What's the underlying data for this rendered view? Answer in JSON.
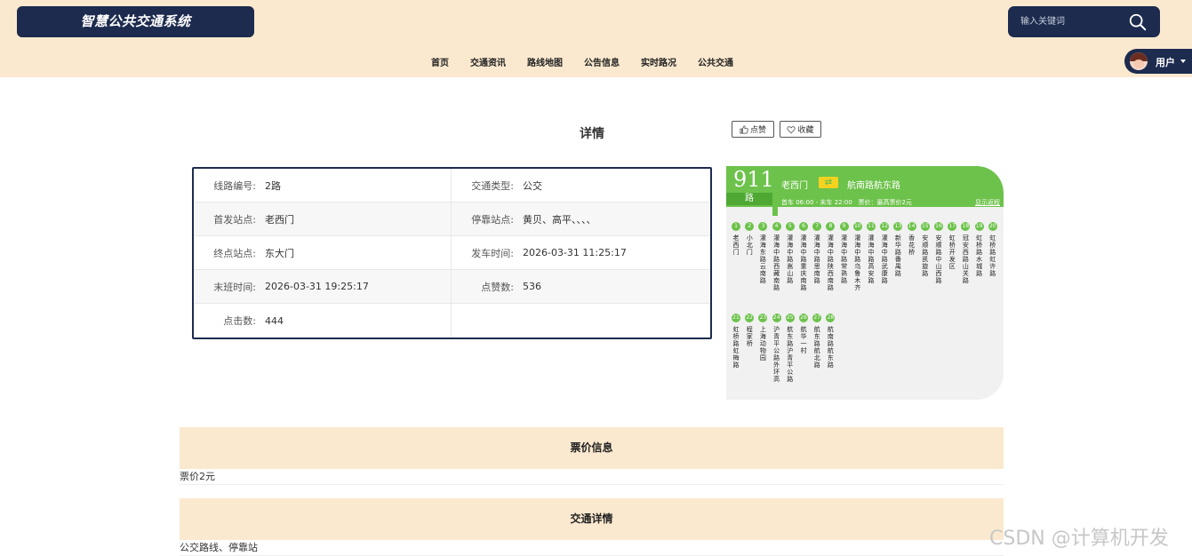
{
  "header": {
    "logo": "智慧公共交通系统",
    "search_placeholder": "输入关键词",
    "nav": [
      "首页",
      "交通资讯",
      "路线地图",
      "公告信息",
      "实时路况",
      "公共交通"
    ],
    "user_label": "用户"
  },
  "detail": {
    "title": "详情",
    "like_label": "点赞",
    "fav_label": "收藏",
    "rows": [
      {
        "label": "线路编号:",
        "value": "2路"
      },
      {
        "label": "交通类型:",
        "value": "公交"
      },
      {
        "label": "首发站点:",
        "value": "老西门"
      },
      {
        "label": "停靠站点:",
        "value": "黄贝、高平、、、、"
      },
      {
        "label": "终点站点:",
        "value": "东大门"
      },
      {
        "label": "发车时间:",
        "value": "2026-03-31 11:25:17"
      },
      {
        "label": "末班时间:",
        "value": "2026-03-31 19:25:17"
      },
      {
        "label": "点赞数:",
        "value": "536"
      },
      {
        "label": "点击数:",
        "value": "444"
      }
    ]
  },
  "route_image": {
    "number": "911",
    "suffix": "路",
    "from": "老西门",
    "to": "航南路航东路",
    "schedule": "首车 06:00 - 末车 22:00",
    "fare": "票价：最高票价2元",
    "back_link": "显示返程",
    "stops_row1": [
      {
        "no": "1",
        "name": "老西门"
      },
      {
        "no": "2",
        "name": "小北门"
      },
      {
        "no": "3",
        "name": "灌海东路云南路"
      },
      {
        "no": "4",
        "name": "灌海中路西藏南路"
      },
      {
        "no": "5",
        "name": "灌海中路嵩山路"
      },
      {
        "no": "6",
        "name": "灌海中路重庆南路"
      },
      {
        "no": "7",
        "name": "灌海中路思南路"
      },
      {
        "no": "8",
        "name": "灌海中路陕西南路"
      },
      {
        "no": "9",
        "name": "灌海中路常熟路"
      },
      {
        "no": "10",
        "name": "灌海中路乌鲁木齐"
      },
      {
        "no": "11",
        "name": "灌海中路高安路"
      },
      {
        "no": "12",
        "name": "灌海中路武康路"
      },
      {
        "no": "13",
        "name": "新华路番禺路"
      },
      {
        "no": "14",
        "name": "香花桥"
      },
      {
        "no": "15",
        "name": "安顺路凯旋路"
      },
      {
        "no": "16",
        "name": "安顺路中山西路"
      },
      {
        "no": "17",
        "name": "虹桥开发区"
      },
      {
        "no": "18",
        "name": "冠安西路山关路"
      },
      {
        "no": "19",
        "name": "虹桥路水城路"
      },
      {
        "no": "20",
        "name": "虹桥路虹许路"
      }
    ],
    "stops_row2": [
      {
        "no": "21",
        "name": "虹桥路虹梅路"
      },
      {
        "no": "22",
        "name": "程家桥"
      },
      {
        "no": "23",
        "name": "上海动物园"
      },
      {
        "no": "24",
        "name": "沪青平公路外环高"
      },
      {
        "no": "25",
        "name": "航东路沪青平公路"
      },
      {
        "no": "26",
        "name": "航华一村"
      },
      {
        "no": "27",
        "name": "航东路航北路"
      },
      {
        "no": "28",
        "name": "航南路航东路"
      }
    ]
  },
  "fare_section": {
    "title": "票价信息",
    "text": "票价2元"
  },
  "traffic_section": {
    "title": "交通详情",
    "text": "公交路线、停靠站"
  },
  "watermark": "CSDN @计算机开发",
  "colors": {
    "header_bg": "#fbe9cf",
    "navy": "#1c2b4e",
    "route_green": "#6cc24a"
  }
}
